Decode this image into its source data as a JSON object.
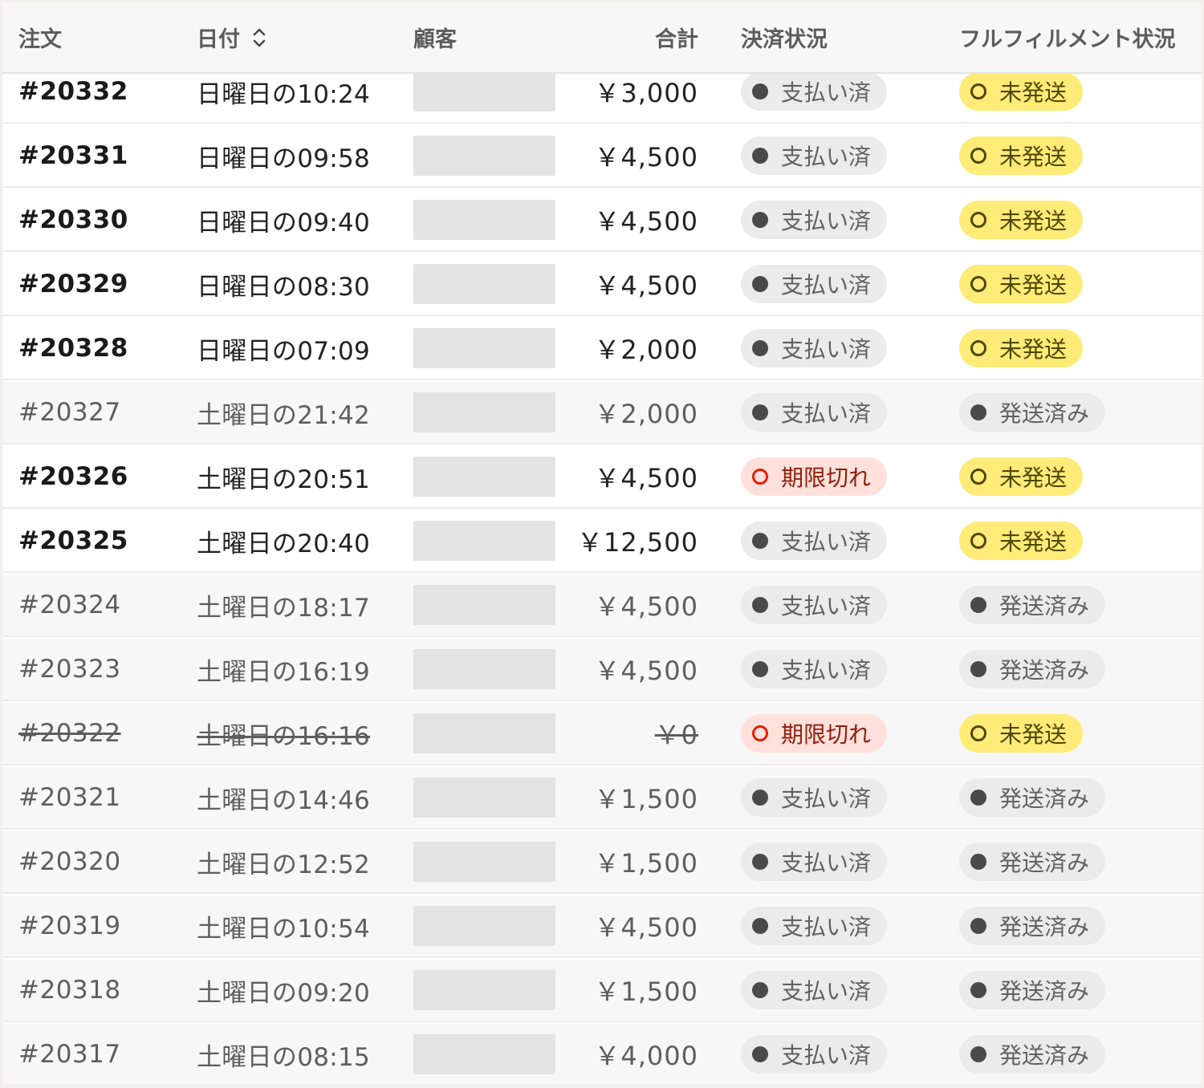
{
  "header": {
    "order": "注文",
    "date": "日付",
    "customer": "顧客",
    "total": "合計",
    "payment_status": "決済状況",
    "fulfillment_status": "フルフィルメント状況",
    "sort_icon": "chevron-up-down-icon"
  },
  "status_colors": {
    "paid": "#ebebeb",
    "unfulfilled": "#ffeb78",
    "expired": "#ffe0db",
    "fulfilled": "#ebebeb"
  },
  "orders": [
    {
      "order": "#20332",
      "date": "日曜日の10:24",
      "total": "￥3,000",
      "payment": "支払い済",
      "fulfillment": "未発送"
    },
    {
      "order": "#20331",
      "date": "日曜日の09:58",
      "total": "￥4,500",
      "payment": "支払い済",
      "fulfillment": "未発送"
    },
    {
      "order": "#20330",
      "date": "日曜日の09:40",
      "total": "￥4,500",
      "payment": "支払い済",
      "fulfillment": "未発送"
    },
    {
      "order": "#20329",
      "date": "日曜日の08:30",
      "total": "￥4,500",
      "payment": "支払い済",
      "fulfillment": "未発送"
    },
    {
      "order": "#20328",
      "date": "日曜日の07:09",
      "total": "￥2,000",
      "payment": "支払い済",
      "fulfillment": "未発送"
    },
    {
      "order": "#20327",
      "date": "土曜日の21:42",
      "total": "￥2,000",
      "payment": "支払い済",
      "fulfillment": "発送済み"
    },
    {
      "order": "#20326",
      "date": "土曜日の20:51",
      "total": "￥4,500",
      "payment": "期限切れ",
      "fulfillment": "未発送"
    },
    {
      "order": "#20325",
      "date": "土曜日の20:40",
      "total": "￥12,500",
      "payment": "支払い済",
      "fulfillment": "未発送"
    },
    {
      "order": "#20324",
      "date": "土曜日の18:17",
      "total": "￥4,500",
      "payment": "支払い済",
      "fulfillment": "発送済み"
    },
    {
      "order": "#20323",
      "date": "土曜日の16:19",
      "total": "￥4,500",
      "payment": "支払い済",
      "fulfillment": "発送済み"
    },
    {
      "order": "#20322",
      "date": "土曜日の16:16",
      "total": "￥0",
      "payment": "期限切れ",
      "fulfillment": "未発送"
    },
    {
      "order": "#20321",
      "date": "土曜日の14:46",
      "total": "￥1,500",
      "payment": "支払い済",
      "fulfillment": "発送済み"
    },
    {
      "order": "#20320",
      "date": "土曜日の12:52",
      "total": "￥1,500",
      "payment": "支払い済",
      "fulfillment": "発送済み"
    },
    {
      "order": "#20319",
      "date": "土曜日の10:54",
      "total": "￥4,500",
      "payment": "支払い済",
      "fulfillment": "発送済み"
    },
    {
      "order": "#20318",
      "date": "土曜日の09:20",
      "total": "￥1,500",
      "payment": "支払い済",
      "fulfillment": "発送済み"
    },
    {
      "order": "#20317",
      "date": "土曜日の08:15",
      "total": "￥4,000",
      "payment": "支払い済",
      "fulfillment": "発送済み"
    }
  ]
}
